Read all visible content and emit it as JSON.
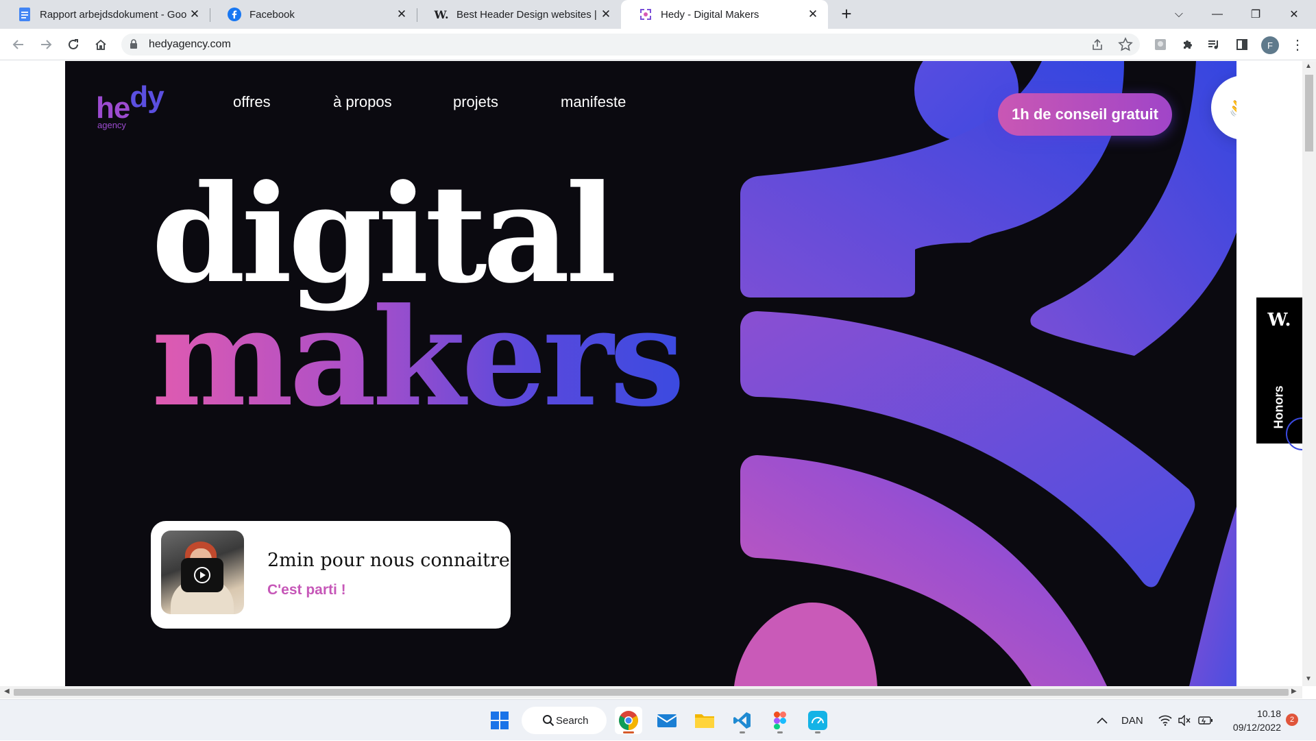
{
  "browser": {
    "tabs": [
      {
        "title": "Rapport arbejdsdokument - Goo",
        "icon": "google-docs-icon"
      },
      {
        "title": "Facebook",
        "icon": "facebook-icon"
      },
      {
        "title": "Best Header Design websites | W",
        "icon": "awwwards-w-icon"
      },
      {
        "title": "Hedy - Digital Makers",
        "icon": "hedy-favicon"
      }
    ],
    "new_tab": "+",
    "url": "hedyagency.com",
    "profile_initial": "F"
  },
  "site": {
    "logo": {
      "he": "he",
      "dy": "dy",
      "sub": "agency"
    },
    "nav": [
      "offres",
      "à propos",
      "projets",
      "manifeste"
    ],
    "cta": "1h de conseil gratuit",
    "wave": "👋",
    "headline_1": "digital",
    "headline_2": "makers",
    "video": {
      "title": "2min pour nous connaitre",
      "subtitle": "C'est parti !"
    },
    "honors": {
      "mark": "W.",
      "label": "Honors"
    }
  },
  "colors": {
    "hero_bg": "#0b0a10",
    "pink": "#d858b4",
    "purple": "#9b4fcf",
    "blue": "#3b4ae0"
  },
  "taskbar": {
    "search_label": "Search",
    "lang": "DAN",
    "time": "10.18",
    "date": "09/12/2022",
    "notifications": "2"
  }
}
